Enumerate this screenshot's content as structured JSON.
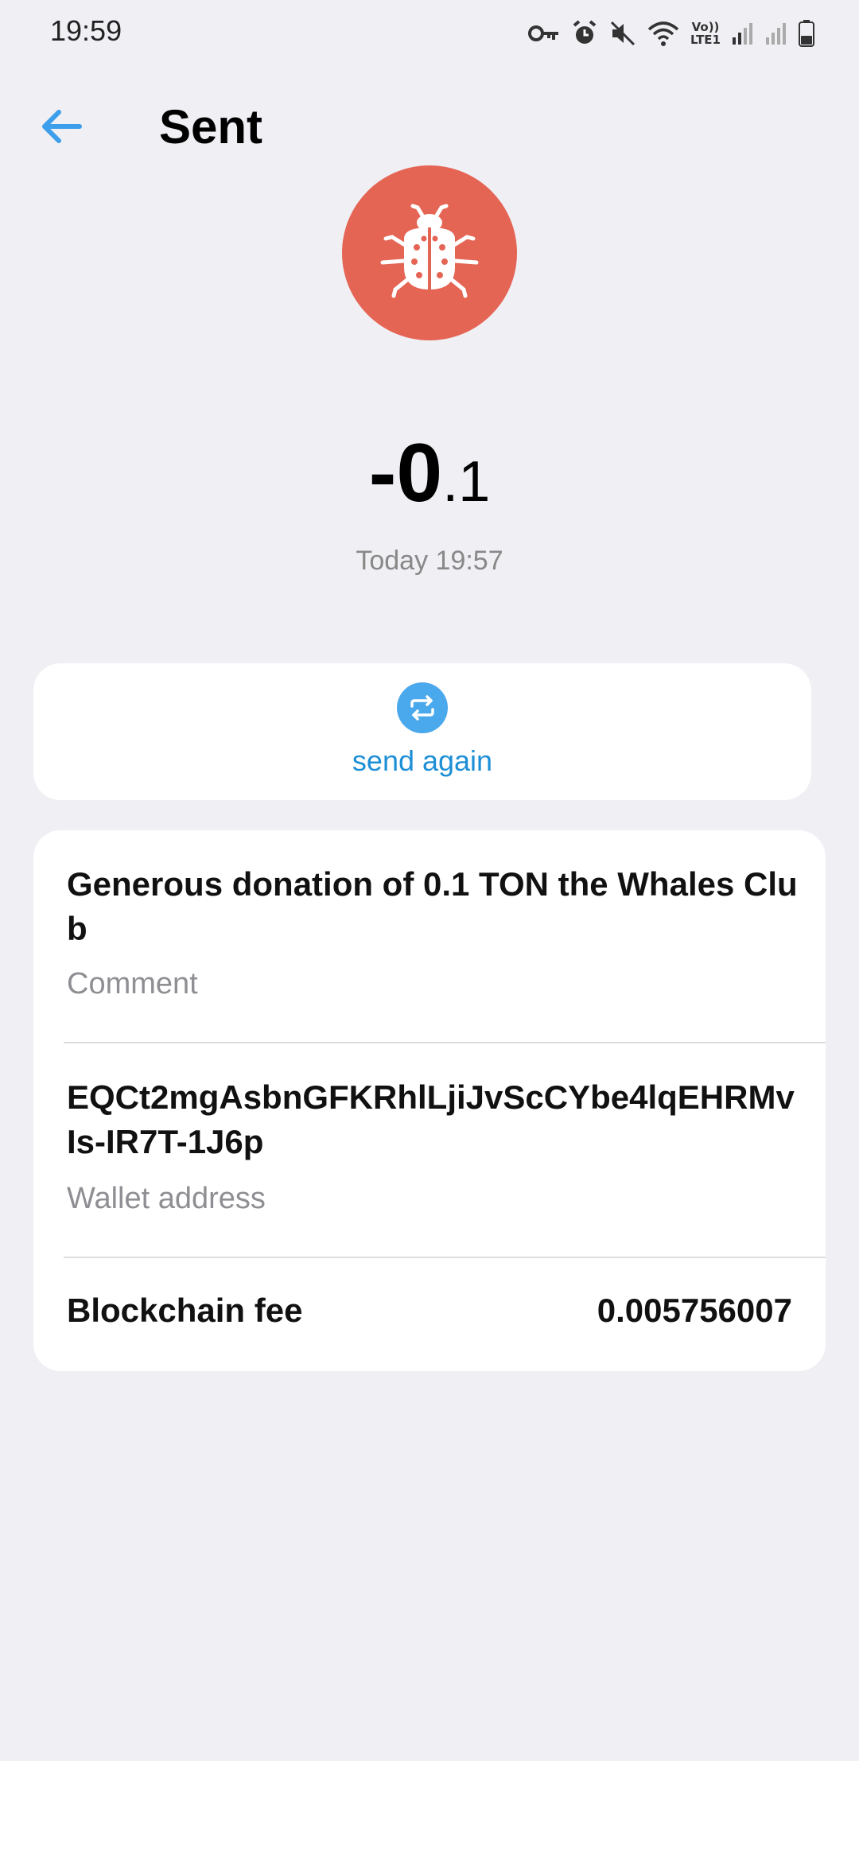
{
  "status_bar": {
    "time": "19:59",
    "lte_top": "Vo))",
    "lte_bottom": "LTE1",
    "icons": [
      "key-icon",
      "alarm-icon",
      "mute-icon",
      "wifi-icon",
      "volte-icon",
      "signal-icon",
      "signal-icon",
      "battery-icon"
    ]
  },
  "header": {
    "title": "Sent",
    "back_icon": "arrow-left-icon"
  },
  "avatar": {
    "icon": "ladybug-icon",
    "background": "#e56555"
  },
  "transaction": {
    "amount_int": "-0",
    "amount_frac": ".1",
    "date": "Today 19:57"
  },
  "send_again": {
    "label": "send again",
    "icon": "repeat-icon",
    "accent": "#4aa8ec"
  },
  "details": {
    "comment_value": "Generous donation of 0.1 TON the Whales Club",
    "comment_label": "Comment",
    "address_value": "EQCt2mgAsbnGFKRhlLjiJvScCYbe4lqEHRMvIs-IR7T-1J6p",
    "address_label": "Wallet address",
    "fee_label": "Blockchain fee",
    "fee_value": "0.005756007"
  }
}
